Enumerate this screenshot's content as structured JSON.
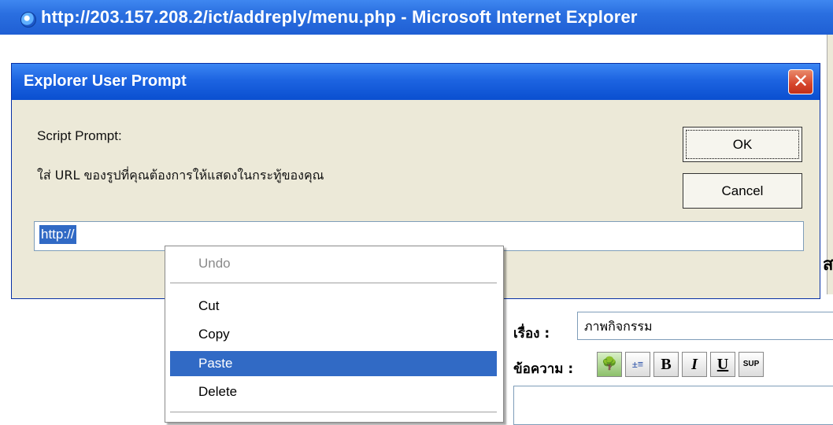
{
  "window": {
    "title": "http://203.157.208.2/ict/addreply/menu.php - Microsoft Internet Explorer"
  },
  "dialog": {
    "title": "Explorer User Prompt",
    "close_label": "✕",
    "prompt_label": "Script Prompt:",
    "message": "ใส่ URL ของรูปที่คุณต้องการให้แสดงในกระทู้ของคุณ",
    "input_value": "http://",
    "ok_label": "OK",
    "cancel_label": "Cancel"
  },
  "context_menu": {
    "items": [
      {
        "label": "Undo",
        "enabled": false
      },
      {
        "label": "Cut",
        "enabled": true
      },
      {
        "label": "Copy",
        "enabled": true
      },
      {
        "label": "Paste",
        "enabled": true,
        "highlighted": true
      },
      {
        "label": "Delete",
        "enabled": true
      }
    ]
  },
  "page": {
    "subject_label": "เรื่อง :",
    "subject_value": "ภาพกิจกรรม",
    "message_label": "ข้อความ :",
    "toolbar": [
      {
        "name": "insert-image-icon",
        "glyph": "🌳"
      },
      {
        "name": "indent-icon",
        "glyph": "±≡"
      },
      {
        "name": "bold-icon",
        "glyph": "B"
      },
      {
        "name": "italic-icon",
        "glyph": "I"
      },
      {
        "name": "underline-icon",
        "glyph": "U"
      },
      {
        "name": "superscript-icon",
        "glyph": "SUP"
      }
    ],
    "side_letter": "ส"
  },
  "colors": {
    "titlebar": "#1f5fd4",
    "dialog_face": "#ece9d8",
    "selection": "#316ac5",
    "close_button": "#d6452c"
  }
}
